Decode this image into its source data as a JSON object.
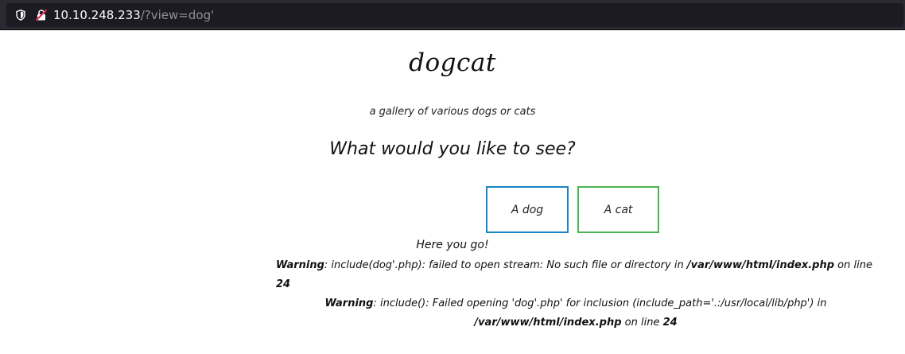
{
  "browser": {
    "url_host": "10.10.248.233",
    "url_path": "/?view=dog'"
  },
  "page": {
    "title": "dogcat",
    "subtitle": "a gallery of various dogs or cats",
    "question": "What would you like to see?",
    "buttons": {
      "dog": "A dog",
      "cat": "A cat"
    },
    "message": "Here you go!",
    "warnings": [
      {
        "label": "Warning",
        "text_before": ": include(dog'.php): failed to open stream: No such file or directory in ",
        "file": "/var/www/html/index.php",
        "text_after": " on line ",
        "line": "24"
      },
      {
        "label": "Warning",
        "text_before": ": include(): Failed opening 'dog'.php' for inclusion (include_path='.:/usr/local/lib/php') in ",
        "file": "/var/www/html/index.php",
        "text_after": " on line ",
        "line": "24"
      }
    ]
  },
  "colors": {
    "dog_button_border": "#1a86c6",
    "cat_button_border": "#4ab553"
  },
  "icons": [
    "shield-icon",
    "insecure-lock-icon"
  ]
}
